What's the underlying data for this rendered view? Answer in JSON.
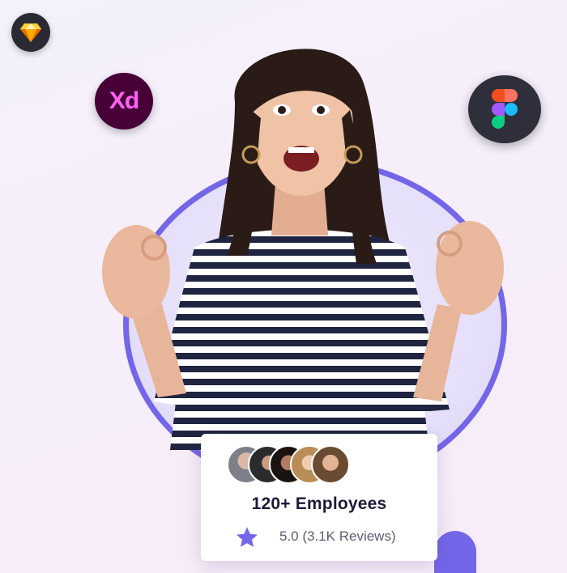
{
  "tools": [
    {
      "name": "sketch",
      "icon": "sketch-diamond-icon"
    },
    {
      "name": "xd",
      "icon": "adobe-xd-icon",
      "text": "Xd"
    },
    {
      "name": "figma",
      "icon": "figma-icon"
    }
  ],
  "colors": {
    "accent": "#7466e8",
    "xd_bg": "#470137",
    "xd_text": "#ff61f6",
    "dark_badge": "#2e2f3a",
    "title": "#1c1c3a",
    "muted": "#5d5d72"
  },
  "card": {
    "title": "120+ Employees",
    "rating": "5.0 (3.1K Reviews)",
    "star_icon": "star-icon",
    "avatar_count": 5
  }
}
